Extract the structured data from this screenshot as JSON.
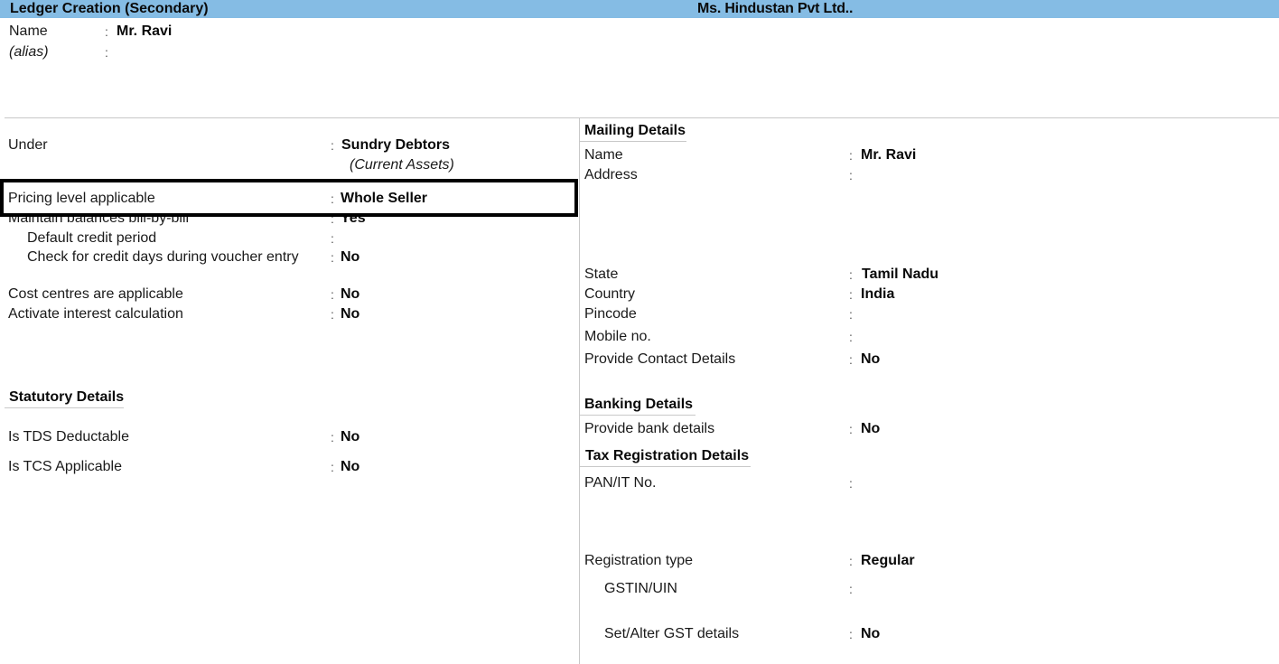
{
  "window": {
    "title": "Ledger Creation (Secondary)",
    "company": "Ms. Hindustan Pvt Ltd.."
  },
  "header": {
    "name_label": "Name",
    "name_value": "Mr. Ravi",
    "alias_label": "(alias)",
    "alias_value": ""
  },
  "left": {
    "under_label": "Under",
    "under_value": "Sundry Debtors",
    "under_group": "(Current Assets)",
    "pricing_label": "Pricing level applicable",
    "pricing_value": "Whole Seller",
    "maintain_label": "Maintain balances bill-by-bill",
    "maintain_value": "Yes",
    "credit_period_label": "Default credit period",
    "credit_period_value": "",
    "check_credit_label": "Check for credit days during voucher entry",
    "check_credit_value": "No",
    "cost_centres_label": "Cost centres are applicable",
    "cost_centres_value": "No",
    "interest_label": "Activate interest calculation",
    "interest_value": "No",
    "statutory_header": "Statutory Details",
    "tds_label": "Is TDS Deductable",
    "tds_value": "No",
    "tcs_label": "Is TCS Applicable",
    "tcs_value": "No"
  },
  "right": {
    "mailing_header": "Mailing Details",
    "name_label": "Name",
    "name_value": "Mr. Ravi",
    "address_label": "Address",
    "address_value": "",
    "state_label": "State",
    "state_value": "Tamil Nadu",
    "country_label": "Country",
    "country_value": "India",
    "pincode_label": "Pincode",
    "pincode_value": "",
    "mobile_label": "Mobile no.",
    "mobile_value": "",
    "contact_label": "Provide Contact Details",
    "contact_value": "No",
    "banking_header": "Banking Details",
    "bank_label": "Provide bank details",
    "bank_value": "No",
    "tax_header": "Tax Registration Details",
    "pan_label": "PAN/IT No.",
    "pan_value": "",
    "regtype_label": "Registration type",
    "regtype_value": "Regular",
    "gstin_label": "GSTIN/UIN",
    "gstin_value": "",
    "gst_details_label": "Set/Alter GST details",
    "gst_details_value": "No"
  },
  "separator": ":"
}
